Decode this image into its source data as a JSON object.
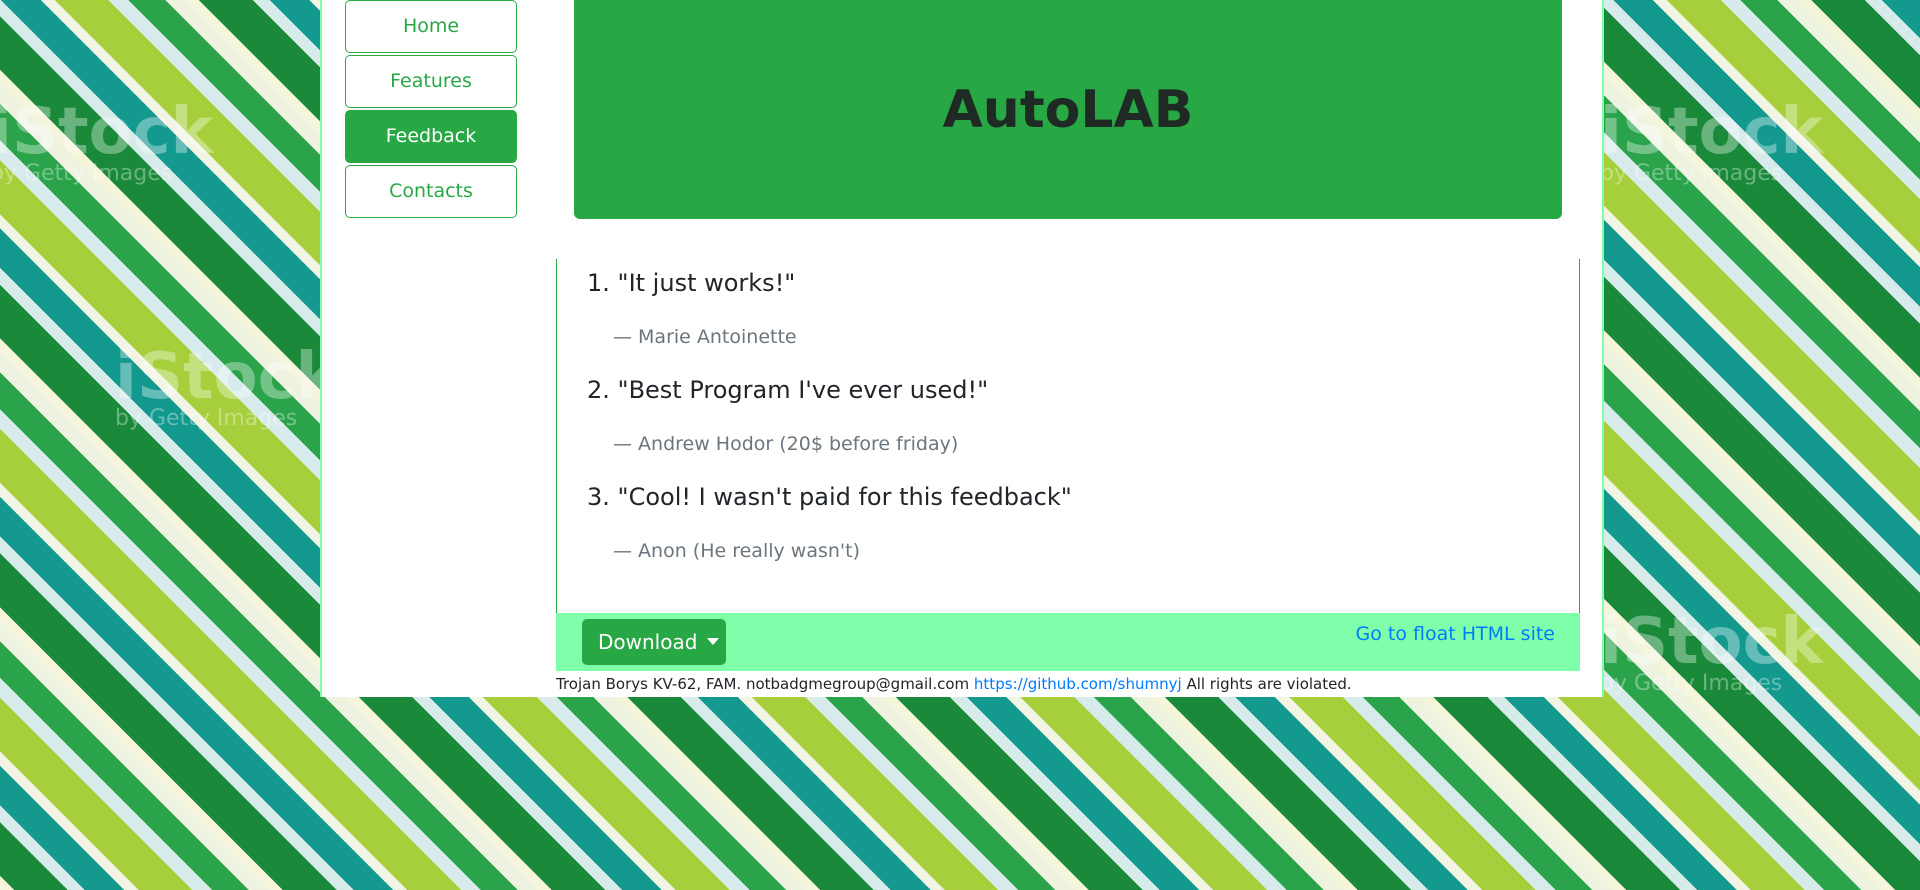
{
  "nav": {
    "items": [
      {
        "label": "Home"
      },
      {
        "label": "Features"
      },
      {
        "label": "Feedback"
      },
      {
        "label": "Contacts"
      }
    ]
  },
  "header": {
    "title": "AutoLAB"
  },
  "feedback": [
    {
      "quote": "1. \"It just works!\"",
      "author": "—  Marie Antoinette"
    },
    {
      "quote": "2. \"Best Program I've ever used!\"",
      "author": "—  Andrew Hodor (20$ before friday)"
    },
    {
      "quote": "3. \"Cool! I wasn't paid for this feedback\"",
      "author": "— Anon (He really wasn't)"
    }
  ],
  "footer": {
    "download_label": "Download",
    "float_link": "Go to float HTML site",
    "credits_text": "Trojan Borys KV-62, FAM. notbadgmegroup@gmail.com",
    "github_link": "https://github.com/shumnyj",
    "rights_text": "All rights are violated."
  },
  "watermarks": {
    "brand": "iStock",
    "sub": "by Getty Images"
  },
  "colors": {
    "accent": "#28a745",
    "footer_bar": "#80ffaa",
    "link": "#007bff"
  }
}
